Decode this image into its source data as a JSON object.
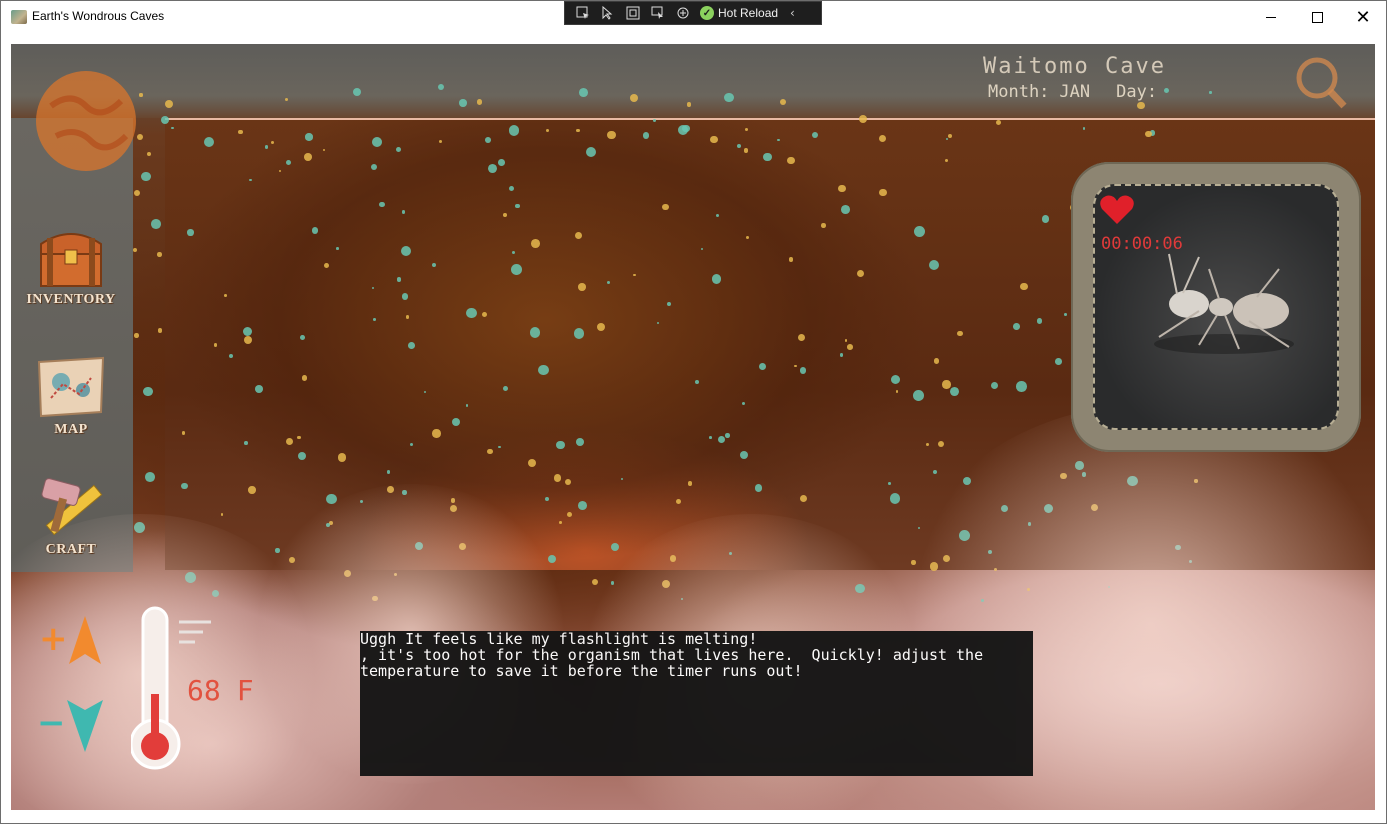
{
  "window": {
    "title": "Earth's Wondrous Caves",
    "controls": {
      "minimize": "",
      "maximize": "",
      "close": "✕"
    }
  },
  "debug_toolbar": {
    "hot_reload_label": "Hot Reload",
    "icons": [
      "select-element-icon",
      "select-pointer-icon",
      "display-layout-icon",
      "track-focus-icon",
      "binding-icon",
      "hot-reload-check-icon",
      "collapse-chevron-icon"
    ]
  },
  "header": {
    "cave_name": "Waitomo Cave",
    "month_label": "Month:",
    "month_value": "JAN",
    "day_label": "Day:",
    "day_value": ""
  },
  "sidebar": {
    "items": [
      {
        "label": "INVENTORY",
        "icon": "treasure-chest-icon"
      },
      {
        "label": "MAP",
        "icon": "map-scroll-icon"
      },
      {
        "label": "CRAFT",
        "icon": "hammer-ruler-icon"
      }
    ]
  },
  "creature": {
    "timer": "00:00:06",
    "icon": "ant-icon",
    "health_icon": "heart-icon"
  },
  "temperature": {
    "value": "68",
    "unit": "F",
    "up_symbol": "+",
    "down_symbol": "−"
  },
  "dialog": {
    "lines": [
      "Uggh It feels like my flashlight is melting!",
      ", it's too hot for the organism that lives here.  Quickly! adjust the",
      "temperature to save it before the timer runs out!"
    ]
  },
  "colors": {
    "accent_teal": "#69c7b1",
    "accent_gold": "#e6b94e",
    "timer_red": "#e03a3a",
    "temp_red": "#e2523f",
    "heart_red": "#e0202a",
    "up_arrow_orange": "#f28a2e",
    "down_arrow_teal": "#3fb8b0"
  }
}
